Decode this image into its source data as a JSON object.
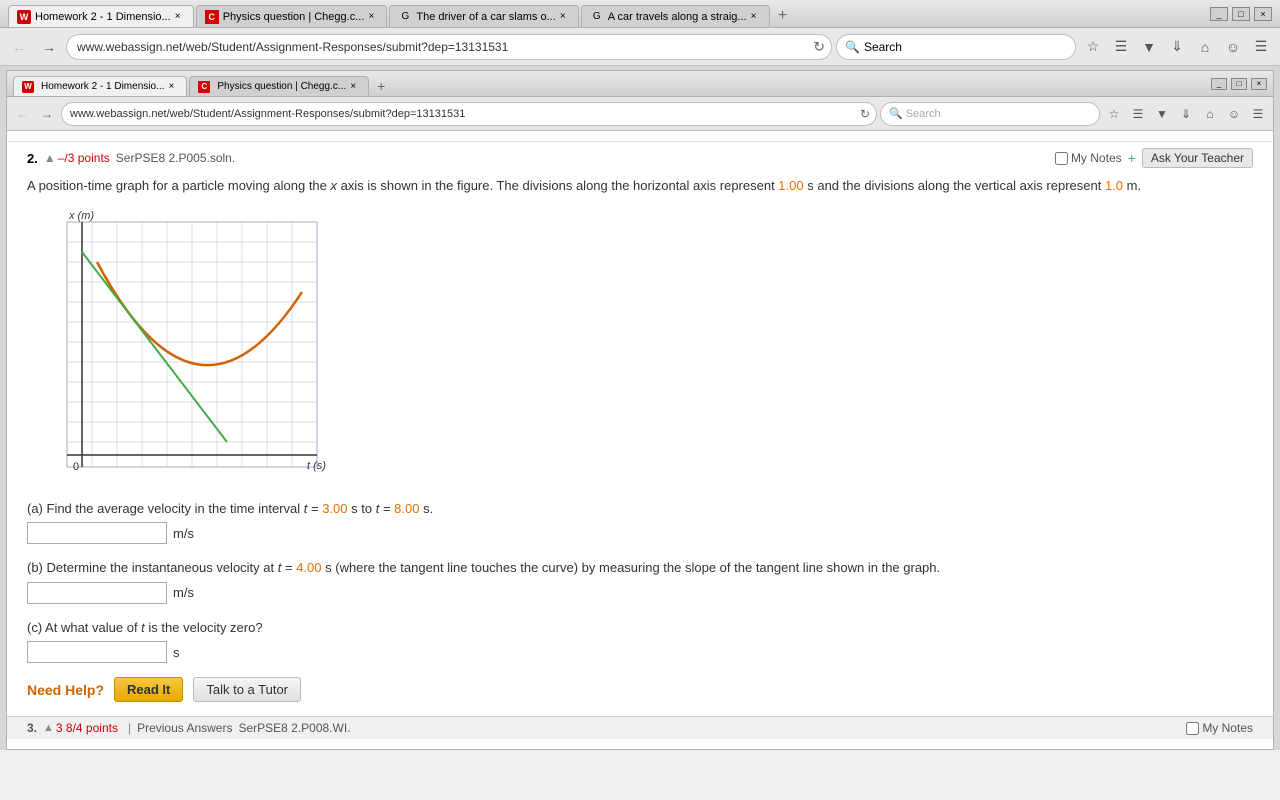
{
  "browser": {
    "outer": {
      "tabs": [
        {
          "id": "tab1",
          "favicon": "WA",
          "label": "Homework 2 - 1 Dimensio...",
          "active": true,
          "closeable": true
        },
        {
          "id": "tab2",
          "favicon": "C",
          "label": "Physics question | Chegg.c...",
          "active": false,
          "closeable": true
        },
        {
          "id": "tab3",
          "favicon": "G",
          "label": "The driver of a car slams o...",
          "active": false,
          "closeable": true
        },
        {
          "id": "tab4",
          "favicon": "G",
          "label": "A car travels along a straig...",
          "active": false,
          "closeable": true
        }
      ],
      "address": "www.webassign.net/web/Student/Assignment-Responses/submit?dep=13131531",
      "search_placeholder": "Search"
    },
    "inner": {
      "tabs": [
        {
          "id": "itab1",
          "favicon": "WA",
          "label": "Homework 2 - 1 Dimensio...",
          "active": true,
          "closeable": true
        },
        {
          "id": "itab2",
          "favicon": "C",
          "label": "Physics question | Chegg.c...",
          "active": false,
          "closeable": true
        }
      ],
      "address": "www.webassign.net/web/Student/Assignment-Responses/submit?dep=13131531",
      "search_placeholder": "Search"
    }
  },
  "problem": {
    "number": "2.",
    "points_prefix": "–/3 points",
    "problem_id": "SerPSE8 2.P005.soln.",
    "my_notes_label": "My Notes",
    "ask_teacher_label": "Ask Your Teacher",
    "description_part1": "A position-time graph for a particle moving along the ",
    "description_x": "x",
    "description_part2": " axis is shown in the figure. The divisions along the horizontal axis represent ",
    "description_time": "1.00",
    "description_part3": " s and the divisions along the vertical axis represent ",
    "description_dist": "1.0",
    "description_part4": " m.",
    "graph": {
      "x_label": "x (m)",
      "t_label": "t (s)",
      "origin_label": "0"
    },
    "parts": [
      {
        "id": "a",
        "label_prefix": "(a) Find the average velocity in the time interval ",
        "t_start_label": "t",
        "eq": " = ",
        "t_start_val": "3.00",
        "middle": " s to ",
        "t_end_label": "t",
        "t_end_val": "8.00",
        "suffix": " s.",
        "unit": "m/s",
        "input_value": ""
      },
      {
        "id": "b",
        "label_prefix": "(b) Determine the instantaneous velocity at ",
        "t_label": "t",
        "eq": " = ",
        "t_val": "4.00",
        "suffix_part1": " s (where the tangent line touches the curve) by measuring the slope of the tangent line shown in the graph.",
        "unit": "m/s",
        "input_value": ""
      },
      {
        "id": "c",
        "label_prefix": "(c) At what value of ",
        "t_label": "t",
        "suffix": " is the velocity zero?",
        "unit": "s",
        "input_value": ""
      }
    ],
    "need_help_label": "Need Help?",
    "read_it_label": "Read It",
    "talk_tutor_label": "Talk to a Tutor"
  },
  "bottom_section": {
    "number": "3.",
    "points": "3 8/4 points",
    "previous_answers": "Previous Answers",
    "problem_id": "SerPSE8 2.P008.WI.",
    "my_notes_label": "My Notes"
  }
}
